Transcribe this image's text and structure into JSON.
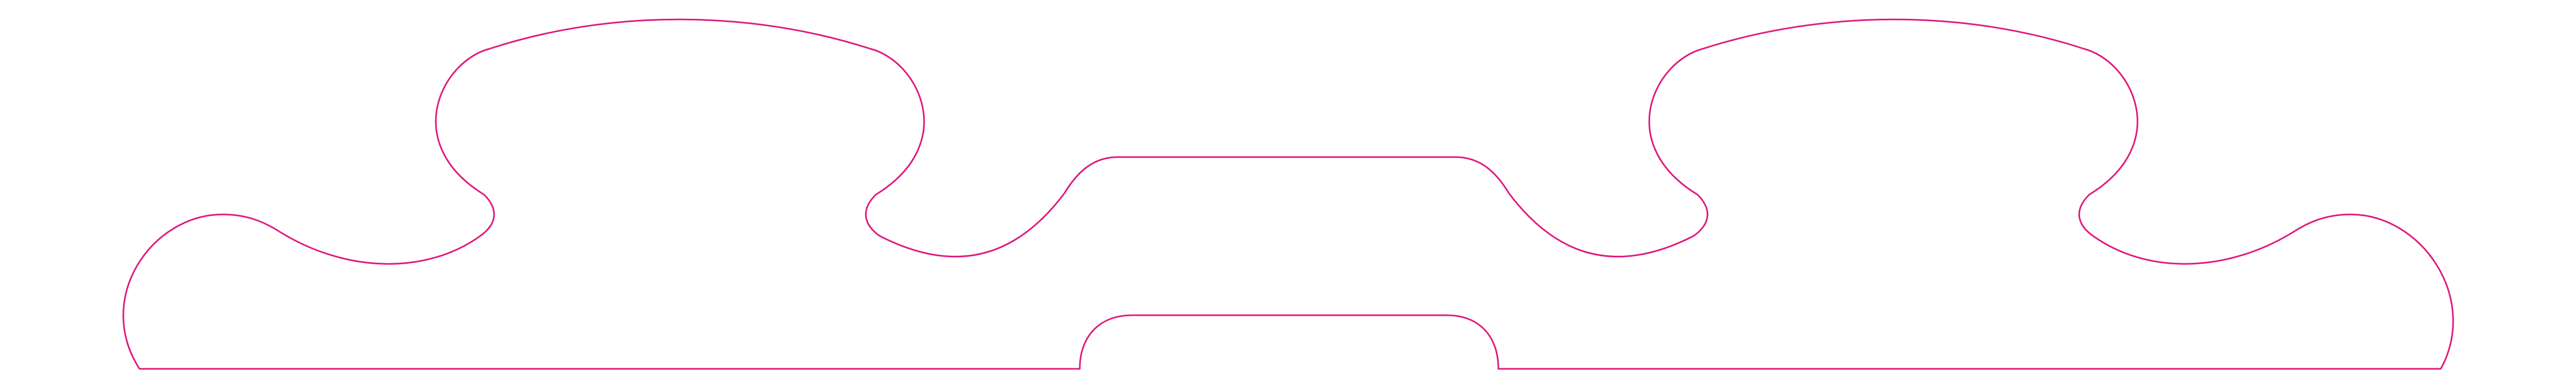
{
  "drawing": {
    "stroke_color": "#e0197d",
    "background_color": "#ffffff",
    "fill": "none",
    "shape": "symmetric cut-out profile outline"
  }
}
